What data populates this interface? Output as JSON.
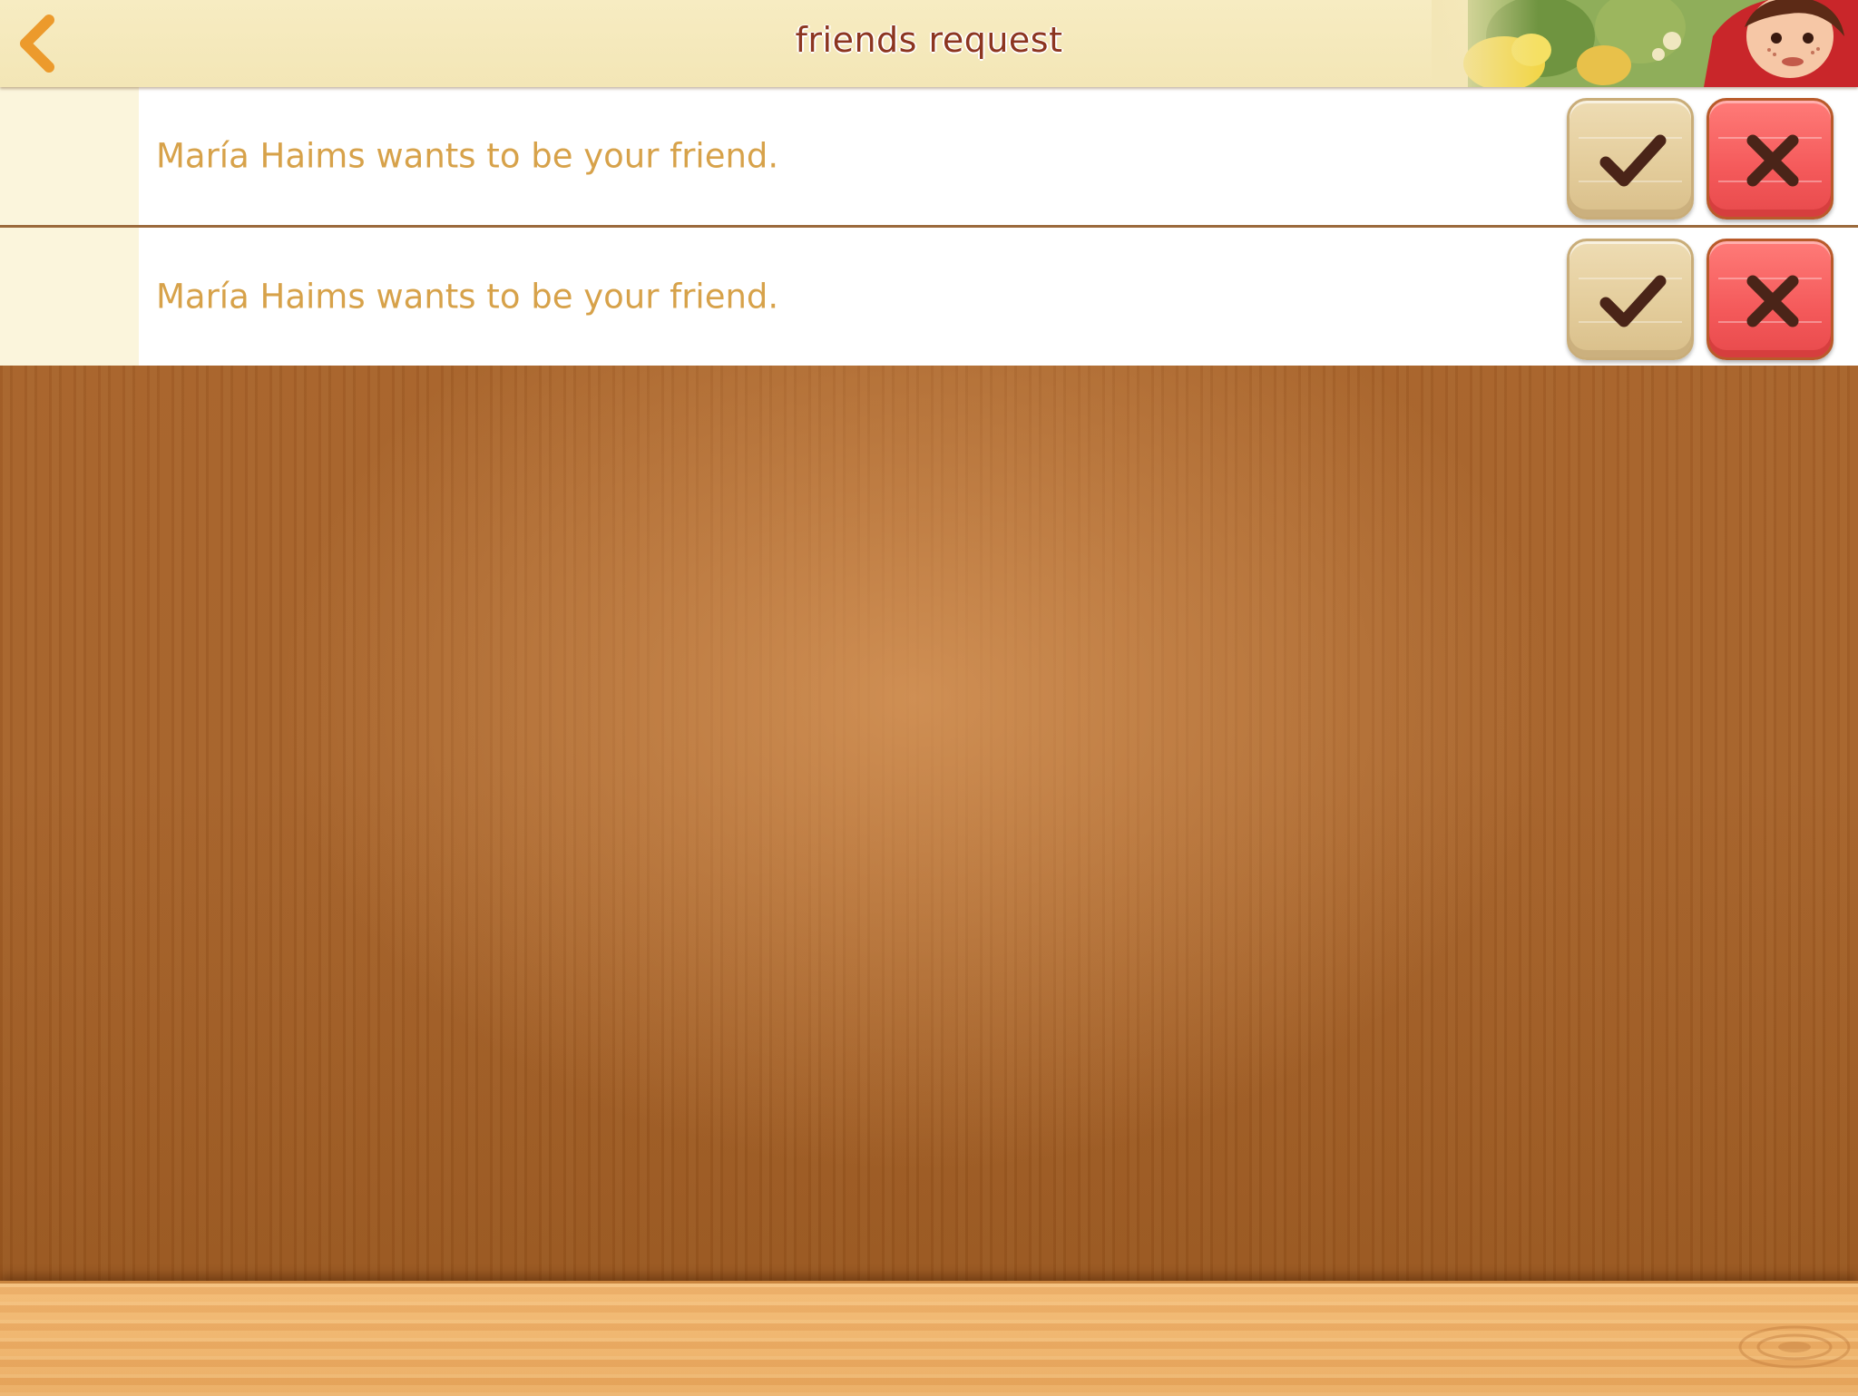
{
  "header": {
    "title": "friends request",
    "back_icon": "chevron-left-icon",
    "illustration": "girl-and-flowers-illustration"
  },
  "requests": [
    {
      "text": "María Haims wants to be your friend.",
      "accept_icon": "checkmark-icon",
      "decline_icon": "close-icon"
    },
    {
      "text": "María Haims wants to be your friend.",
      "accept_icon": "checkmark-icon",
      "decline_icon": "close-icon"
    }
  ],
  "colors": {
    "header_bg": "#f3e6b6",
    "title": "#8c3520",
    "back_arrow": "#ec9a2c",
    "request_text": "#d7a24a",
    "accept_button": "#e4cd9c",
    "decline_button": "#f4595a",
    "icon_dark": "#4a2418",
    "wood": "#a5622a",
    "shelf": "#eeb06a"
  }
}
